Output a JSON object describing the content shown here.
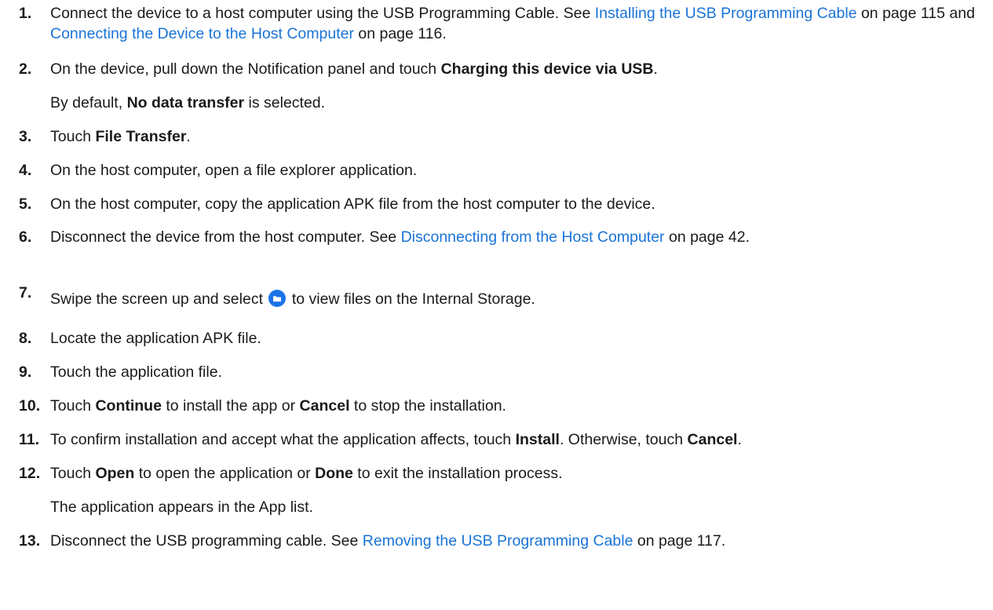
{
  "steps": [
    {
      "num": "1.",
      "a": "Connect the device to a host computer using the USB Programming Cable. See ",
      "link1": "Installing the USB Programming Cable",
      "b": " on page 115 and ",
      "link2": "Connecting the Device to the Host Computer",
      "c": " on page 116."
    },
    {
      "num": "2.",
      "a": "On the device, pull down the Notification panel and touch ",
      "bold": "Charging this device via USB",
      "b": ".",
      "sub_a": "By default, ",
      "sub_bold": "No data transfer",
      "sub_b": " is selected."
    },
    {
      "num": "3.",
      "a": "Touch ",
      "bold": "File Transfer",
      "b": "."
    },
    {
      "num": "4.",
      "a": "On the host computer, open a file explorer application."
    },
    {
      "num": "5.",
      "a": "On the host computer, copy the application APK file from the host computer to the device."
    },
    {
      "num": "6.",
      "a": "Disconnect the device from the host computer. See ",
      "link1": "Disconnecting from the Host Computer",
      "b": " on page 42."
    },
    {
      "num": "7.",
      "a": "Swipe the screen up and select ",
      "b": " to view files on the Internal Storage.",
      "icon": "folder-icon",
      "icon_color": "#1a73e8"
    },
    {
      "num": "8.",
      "a": "Locate the application APK file."
    },
    {
      "num": "9.",
      "a": "Touch the application file."
    },
    {
      "num": "10.",
      "a": "Touch ",
      "bold1": "Continue",
      "b": " to install the app or ",
      "bold2": "Cancel",
      "c": " to stop the installation."
    },
    {
      "num": "11.",
      "a": "To confirm installation and accept what the application affects, touch ",
      "bold1": "Install",
      "b": ". Otherwise, touch ",
      "bold2": "Cancel",
      "c": "."
    },
    {
      "num": "12.",
      "a": "Touch ",
      "bold1": "Open",
      "b": " to open the application or ",
      "bold2": "Done",
      "c": " to exit the installation process.",
      "sub": "The application appears in the App list."
    },
    {
      "num": "13.",
      "a": "Disconnect the USB programming cable. See ",
      "link1": "Removing the USB Programming Cable",
      "b": " on page 117."
    }
  ],
  "colors": {
    "text": "#1a1a1a",
    "link": "#1a73d6"
  }
}
